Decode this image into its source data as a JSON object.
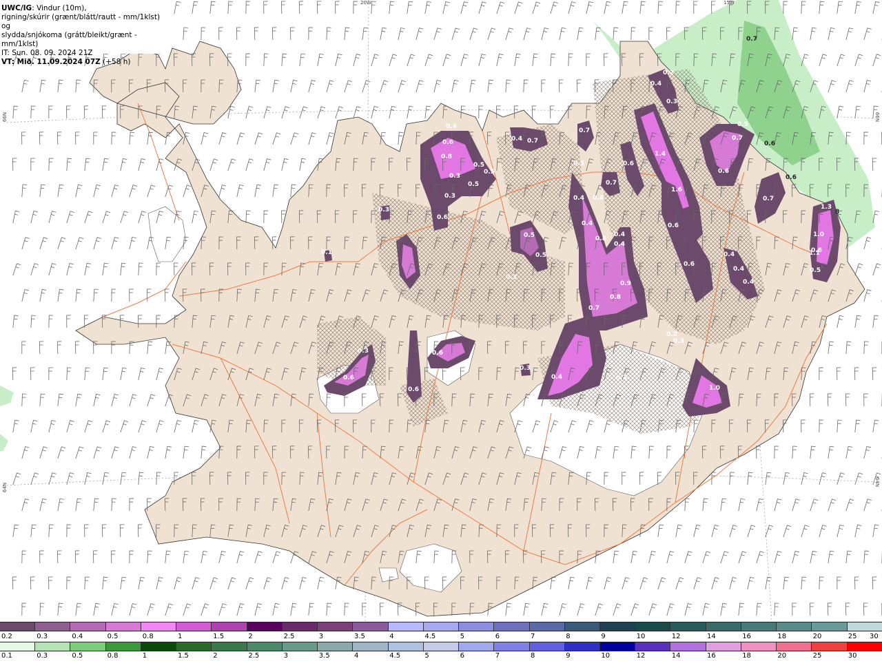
{
  "header": {
    "model": "UWC/IG",
    "line1": ": Vindur (10m),",
    "line2": "rigning/skúrir (grænt/blátt/rautt - mm/1klst) og",
    "line3": "slydda/snjókoma (grátt/bleikt/grænt - mm/1klst)",
    "it": "IT: Sun. 08. 09. 2024 21Z",
    "vt": "VT: Mið. 11.09.2024 07Z",
    "vt_offset": " (+58 h)"
  },
  "grid_labels": {
    "w20": "20W",
    "w15": "15W",
    "n66_left": "66N",
    "n66_right": "66N",
    "n64_left": "64N",
    "n64_right": "64N"
  },
  "colors": {
    "land": "#f0e2d2",
    "sea": "#ffffff",
    "roads": "#ef7a45",
    "glacier": "#ffffff",
    "hatch": "#8a7a70"
  },
  "precip_labels": [
    {
      "v": "0.2"
    },
    {
      "v": "0.4"
    },
    {
      "v": "0.3"
    },
    {
      "v": "0.4"
    },
    {
      "v": "0.6"
    },
    {
      "v": "0.8"
    },
    {
      "v": "0.3"
    },
    {
      "v": "0.5"
    },
    {
      "v": "0.5"
    },
    {
      "v": "0.5"
    },
    {
      "v": "0.3"
    },
    {
      "v": "0.6"
    },
    {
      "v": "0.4"
    },
    {
      "v": "0.7"
    },
    {
      "v": "0.7"
    },
    {
      "v": "0.3"
    },
    {
      "v": "0.6"
    },
    {
      "v": "1.4"
    },
    {
      "v": "0.7"
    },
    {
      "v": "1.6"
    },
    {
      "v": "0.4"
    },
    {
      "v": "0.4"
    },
    {
      "v": "0.4"
    },
    {
      "v": "0.8"
    },
    {
      "v": "0.4"
    },
    {
      "v": "0.4"
    },
    {
      "v": "0.6"
    },
    {
      "v": "0.9"
    },
    {
      "v": "0.8"
    },
    {
      "v": "0.7"
    },
    {
      "v": "0.5"
    },
    {
      "v": "0.5"
    },
    {
      "v": "0.6"
    },
    {
      "v": "0.7"
    },
    {
      "v": "0.6"
    },
    {
      "v": "0.7"
    },
    {
      "v": "1.3"
    },
    {
      "v": "1.0"
    },
    {
      "v": "0.5"
    },
    {
      "v": "0.4"
    },
    {
      "v": "0.4"
    },
    {
      "v": "0.4"
    },
    {
      "v": "1.1"
    },
    {
      "v": "0.6"
    },
    {
      "v": "0.5"
    },
    {
      "v": "0.3"
    },
    {
      "v": "0.2"
    },
    {
      "v": "0.3"
    },
    {
      "v": "0.4"
    },
    {
      "v": "0.3"
    },
    {
      "v": "1.0"
    },
    {
      "v": "0.3"
    },
    {
      "v": "0.6"
    },
    {
      "v": "0.6"
    },
    {
      "v": "0.6"
    },
    {
      "v": "0.1"
    },
    {
      "v": "0.3"
    },
    {
      "v": "0.3"
    },
    {
      "v": "0.7"
    },
    {
      "v": "0.6"
    },
    {
      "v": "0.6"
    },
    {
      "v": "8"
    }
  ],
  "legend_snow": {
    "labels": [
      "0.2",
      "0.3",
      "0.4",
      "0.5",
      "0.8",
      "1",
      "1.5",
      "2",
      "2.5",
      "3",
      "3.5",
      "4",
      "4.5",
      "5",
      "6",
      "7",
      "8",
      "9",
      "10",
      "12",
      "14",
      "16",
      "18",
      "20",
      "25",
      "30"
    ],
    "colors": [
      "#6b4a6b",
      "#8e5e8e",
      "#b36bb3",
      "#d67ad6",
      "#f286f2",
      "#d65cd6",
      "#b042b0",
      "#5a0060",
      "#6a2a6a",
      "#7a407a",
      "#8c5a9c",
      "#b8b8ff",
      "#a8a8f0",
      "#8c8ce0",
      "#7070c0",
      "#5a6aa8",
      "#3a5a7a",
      "#1e4050",
      "#1a4a4a",
      "#2a5a5a",
      "#3a6a6a",
      "#4a7a7a",
      "#5a8a8a",
      "#6a9a9a",
      "#c0d8d8"
    ]
  },
  "legend_rain": {
    "labels": [
      "0.1",
      "0.3",
      "0.5",
      "0.8",
      "1",
      "1.5",
      "2",
      "2.5",
      "3",
      "3.5",
      "4",
      "4.5",
      "5",
      "6",
      "7",
      "8",
      "9",
      "10",
      "12",
      "14",
      "16",
      "18",
      "20",
      "25",
      "30"
    ],
    "colors": [
      "#e4f8e4",
      "#b4e4b4",
      "#7ccc7c",
      "#3a9a3a",
      "#0a4a0a",
      "#2a6a2a",
      "#3a7a4a",
      "#4a8a6a",
      "#6a9a8a",
      "#8aaaaa",
      "#a0b4c8",
      "#b0c0e0",
      "#c4cce8",
      "#a0a8f0",
      "#8080e8",
      "#6060e0",
      "#3030c8",
      "#0000a0",
      "#5a30c0",
      "#b070e0",
      "#e0a0e0",
      "#f090c0",
      "#f07090",
      "#f04040",
      "#ff0000"
    ]
  }
}
